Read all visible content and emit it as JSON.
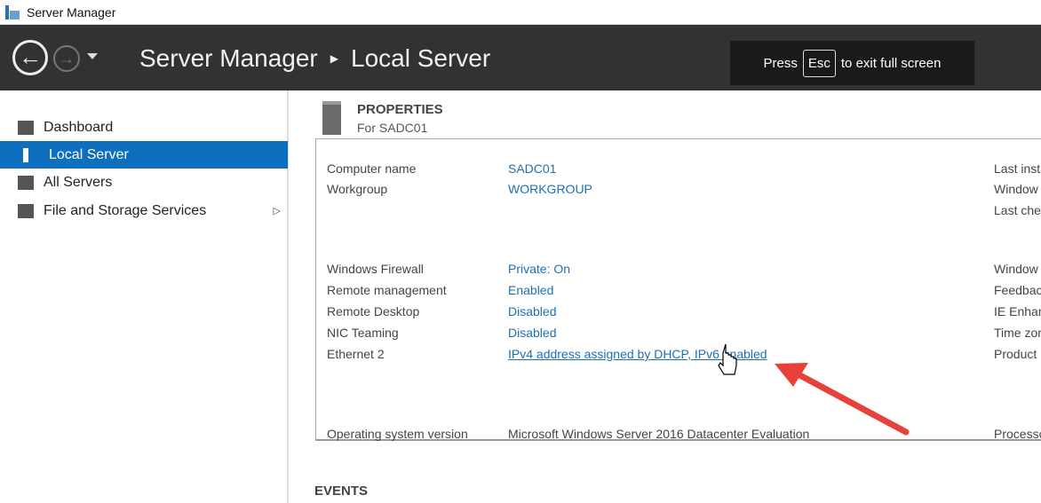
{
  "window": {
    "title": "Server Manager"
  },
  "header": {
    "breadcrumb": [
      "Server Manager",
      "Local Server"
    ],
    "fullscreen_notice": {
      "press": "Press",
      "key": "Esc",
      "rest": "to exit full screen"
    }
  },
  "sidebar": {
    "items": [
      {
        "label": "Dashboard",
        "icon": "dashboard-icon"
      },
      {
        "label": "Local Server",
        "icon": "server-icon",
        "active": true
      },
      {
        "label": "All Servers",
        "icon": "servers-icon"
      },
      {
        "label": "File and Storage Services",
        "icon": "storage-icon",
        "expandable": true
      }
    ]
  },
  "properties": {
    "title": "PROPERTIES",
    "subtitle": "For SADC01",
    "rows": [
      {
        "label": "Computer name",
        "value": "SADC01"
      },
      {
        "label": "Workgroup",
        "value": "WORKGROUP"
      },
      {
        "label": "Windows Firewall",
        "value": "Private: On"
      },
      {
        "label": "Remote management",
        "value": "Enabled"
      },
      {
        "label": "Remote Desktop",
        "value": "Disabled"
      },
      {
        "label": "NIC Teaming",
        "value": "Disabled"
      },
      {
        "label": "Ethernet 2",
        "value": "IPv4 address assigned by DHCP, IPv6 enabled"
      },
      {
        "label": "Operating system version",
        "value": "Microsoft Windows Server 2016 Datacenter Evaluation"
      }
    ],
    "right_labels": [
      "Last insta",
      "Window",
      "Last chec",
      "Window",
      "Feedbac",
      "IE Enhan",
      "Time zor",
      "Product",
      "Processo"
    ]
  },
  "events": {
    "title": "EVENTS"
  },
  "colors": {
    "accent": "#0d6fbe",
    "link": "#1e6fb7",
    "header": "#323232",
    "annotation_arrow": "#e8403a"
  }
}
